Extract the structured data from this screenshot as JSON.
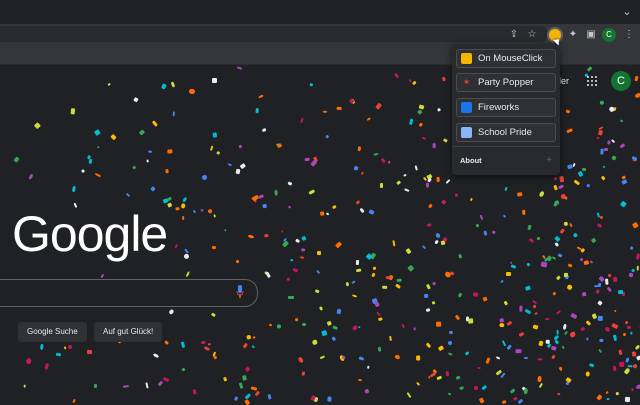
{
  "window": {
    "chevron_icon": "chevron-down-icon"
  },
  "toolbar": {
    "icons": [
      "share-icon",
      "star-icon",
      "extension-active-icon",
      "puzzle-icon",
      "side-panel-icon",
      "profile-icon"
    ],
    "profile_initial": "C"
  },
  "google": {
    "logo_text": "Google",
    "search_button": "Google Suche",
    "lucky_button": "Auf gut Glück!",
    "header_link_text": "der",
    "avatar_initial": "C"
  },
  "popup": {
    "items": [
      {
        "label": "On MouseClick",
        "icon": "smiley-icon"
      },
      {
        "label": "Party Popper",
        "icon": "party-popper-icon"
      },
      {
        "label": "Fireworks",
        "icon": "fireworks-icon"
      },
      {
        "label": "School Pride",
        "icon": "school-pride-icon"
      }
    ],
    "about_label": "About",
    "about_toggle": "+"
  },
  "colors": {
    "background": "#202124",
    "toolbar": "#35363a",
    "popup_bg": "#292a2d",
    "avatar": "#137333",
    "confetti": [
      "#ea4335",
      "#34a853",
      "#fbbc05",
      "#4285f4",
      "#ab47bc",
      "#ff6d00",
      "#e8eaed",
      "#c2185b",
      "#00bcd4",
      "#cddc39"
    ]
  }
}
